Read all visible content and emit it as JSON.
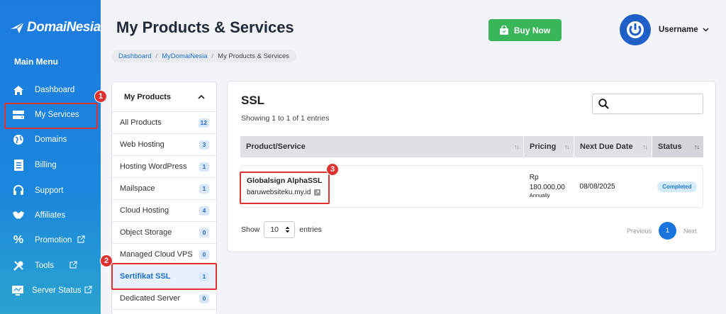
{
  "brand": {
    "name": "DomaiNesia"
  },
  "sidebar": {
    "heading": "Main Menu",
    "items": [
      {
        "label": "Dashboard"
      },
      {
        "label": "My Services"
      },
      {
        "label": "Domains"
      },
      {
        "label": "Billing"
      },
      {
        "label": "Support"
      },
      {
        "label": "Affiliates"
      },
      {
        "label": "Promotion"
      },
      {
        "label": "Tools"
      },
      {
        "label": "Server Status"
      }
    ]
  },
  "header": {
    "title": "My Products & Services",
    "buy_now": "Buy Now",
    "username": "Username"
  },
  "breadcrumb": [
    "Dashboard",
    "MyDomaiNesia",
    "My Products & Services"
  ],
  "products_panel": {
    "title": "My Products",
    "items": [
      {
        "label": "All Products",
        "count": "12"
      },
      {
        "label": "Web Hosting",
        "count": "3"
      },
      {
        "label": "Hosting WordPress",
        "count": "1"
      },
      {
        "label": "Mailspace",
        "count": "1"
      },
      {
        "label": "Cloud Hosting",
        "count": "4"
      },
      {
        "label": "Object Storage",
        "count": "0"
      },
      {
        "label": "Managed Cloud VPS",
        "count": "0"
      },
      {
        "label": "Sertifikat SSL",
        "count": "1"
      },
      {
        "label": "Dedicated Server",
        "count": "0"
      }
    ]
  },
  "main": {
    "title": "SSL",
    "showing": "Showing 1 to 1 of 1 entries",
    "table": {
      "headers": [
        "Product/Service",
        "Pricing",
        "Next Due Date",
        "Status"
      ],
      "rows": [
        {
          "product": "Globalsign AlphaSSL",
          "domain": "baruwebsiteku.my.id",
          "pricing_currency": "Rp",
          "pricing_amount": "180.000,00",
          "pricing_cycle": "Annually",
          "due_date": "08/08/2025",
          "status": "Completed"
        }
      ]
    },
    "show_label": "Show",
    "show_value": "10",
    "entries_label": "entries",
    "pagination": {
      "previous": "Previous",
      "current": "1",
      "next": "Next"
    }
  },
  "annotations": [
    "1",
    "2",
    "3"
  ],
  "colors": {
    "accent": "#1a74e0",
    "buy_now": "#39b65a",
    "highlight": "#e03131"
  }
}
